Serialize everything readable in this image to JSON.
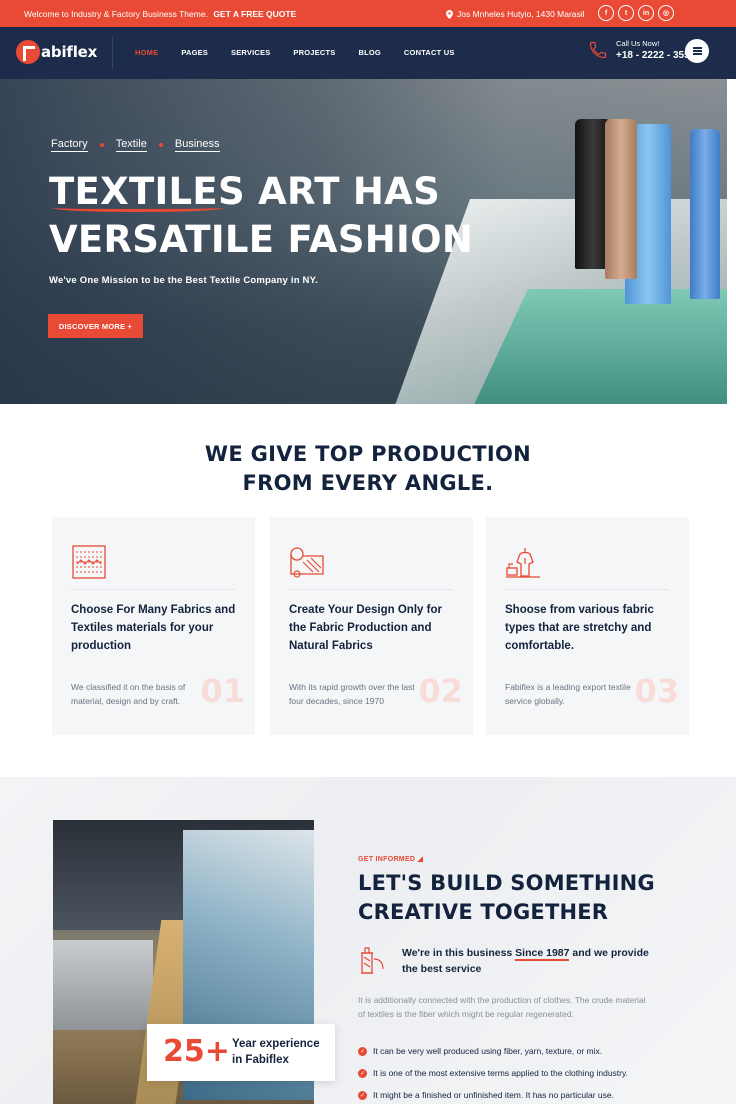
{
  "topbar": {
    "welcome": "Welcome to Industry & Factory Business Theme.",
    "quote_link": "GET A FREE QUOTE",
    "address": "Jos Mnheles Hutyio, 1430 Marasil",
    "socials": [
      {
        "icon": "facebook-icon",
        "glyph": "f"
      },
      {
        "icon": "twitter-icon",
        "glyph": "t"
      },
      {
        "icon": "linkedin-icon",
        "glyph": "in"
      },
      {
        "icon": "instagram-icon",
        "glyph": "◎"
      }
    ]
  },
  "header": {
    "logo_text": "abiflex",
    "nav": [
      "HOME",
      "PAGES",
      "SERVICES",
      "PROJECTS",
      "BLOG",
      "CONTACT US"
    ],
    "active_nav": "HOME",
    "call_label": "Call Us Now!",
    "call_number": "+18 - 2222 - 3555"
  },
  "hero": {
    "tags": [
      "Factory",
      "Textile",
      "Business"
    ],
    "title_line1": "TEXTILES ART HAS",
    "title_line2": "VERSATILE FASHION",
    "subtitle": "We've One Mission to be the Best Textile Company in NY.",
    "cta": "DISCOVER MORE +"
  },
  "features": {
    "title_line1": "WE GIVE TOP PRODUCTION",
    "title_line2": "FROM EVERY ANGLE.",
    "cards": [
      {
        "icon": "fabric-swatch-icon",
        "title": "Choose For Many Fabrics and Textiles materials for your production",
        "desc": "We classified it on the basis of material, design and by craft.",
        "num": "01"
      },
      {
        "icon": "fabric-roll-icon",
        "title": "Create Your Design Only for the Fabric Production and Natural Fabrics",
        "desc": "With its rapid growth over the last four decades, since 1970",
        "num": "02"
      },
      {
        "icon": "sewing-mannequin-icon",
        "title": "Shoose from various fabric types that are stretchy and comfortable.",
        "desc": "Fabiflex is a leading export textile service globally.",
        "num": "03"
      }
    ]
  },
  "about": {
    "kicker": "GET INFORMED",
    "title_line1": "LET'S BUILD SOMETHING",
    "title_line2": "CREATIVE TOGETHER",
    "since_pre": "We're in this business ",
    "since_year": "Since 1987",
    "since_post": " and we provide the best service",
    "paragraph": "It is additionally connected with the production of clothes. The crude material of textiles is the fiber which might be regular regenerated.",
    "checks": [
      "It can be very well produced using fiber, yarn, texture, or mix.",
      "It is one of the most extensive terms applied to the clothing industry.",
      "It might be a finished or unfinished item. It has no particular use."
    ],
    "experience_number": "25+",
    "experience_label": "Year experience in Fabiflex"
  },
  "colors": {
    "accent": "#e84a35",
    "navy": "#1d2c4a",
    "card_bg": "#f5f6f8"
  }
}
